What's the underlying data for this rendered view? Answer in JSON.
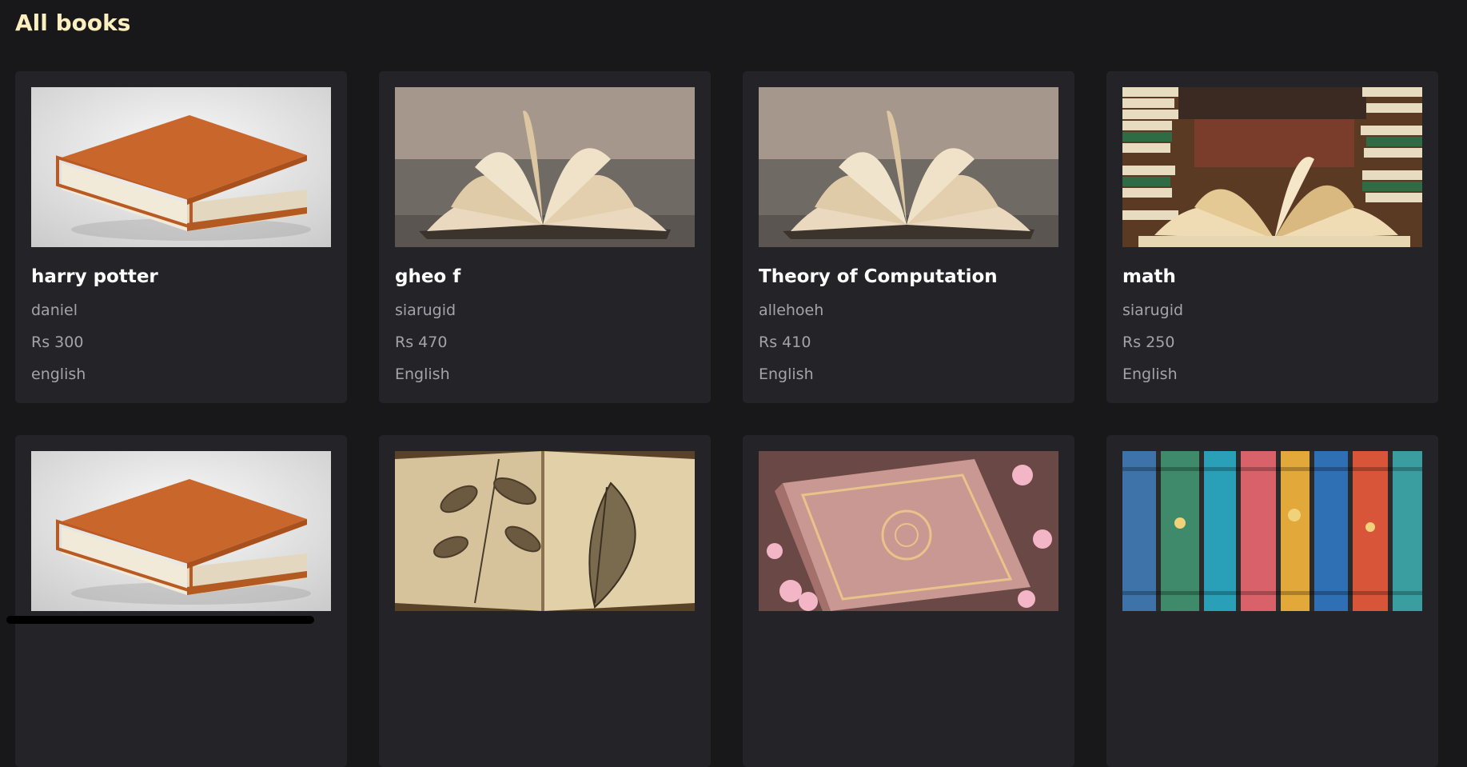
{
  "page": {
    "title": "All books"
  },
  "books": [
    {
      "title": "harry potter",
      "author": "daniel",
      "price": "Rs 300",
      "language": "english",
      "cover_icon": "orange-book-icon"
    },
    {
      "title": "gheo f",
      "author": "siarugid",
      "price": "Rs 470",
      "language": "English",
      "cover_icon": "open-book-icon"
    },
    {
      "title": "Theory of Computation",
      "author": "allehoeh",
      "price": "Rs 410",
      "language": "English",
      "cover_icon": "open-book-icon"
    },
    {
      "title": "math",
      "author": "siarugid",
      "price": "Rs 250",
      "language": "English",
      "cover_icon": "library-books-icon"
    },
    {
      "cover_icon": "orange-book-icon"
    },
    {
      "cover_icon": "botanical-book-icon"
    },
    {
      "cover_icon": "ornate-pink-book-icon"
    },
    {
      "cover_icon": "book-spines-icon"
    }
  ],
  "colors": {
    "background": "#18181b",
    "card": "#242428",
    "title_accent": "#fbeebf",
    "meta_text": "#a3a3a8"
  }
}
